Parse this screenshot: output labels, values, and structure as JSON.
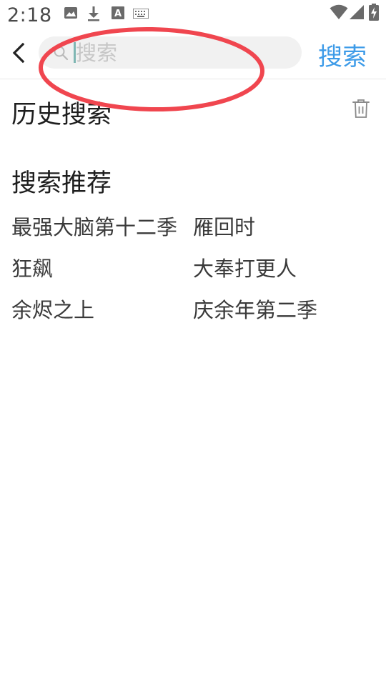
{
  "status_bar": {
    "time": "2:18",
    "left_icons": [
      "image-icon",
      "download-icon",
      "font-a-icon",
      "keyboard-icon"
    ],
    "right_icons": [
      "wifi-icon",
      "signal-icon",
      "battery-charging-icon"
    ]
  },
  "header": {
    "search_placeholder": "搜索",
    "search_button_label": "搜索"
  },
  "history": {
    "title": "历史搜索"
  },
  "recommend": {
    "title": "搜索推荐",
    "items": [
      "最强大脑第十二季",
      "雁回时",
      "狂飙",
      "大奉打更人",
      "余烬之上",
      "庆余年第二季"
    ]
  },
  "colors": {
    "accent": "#3d9be8",
    "annotation": "#f0464f"
  }
}
